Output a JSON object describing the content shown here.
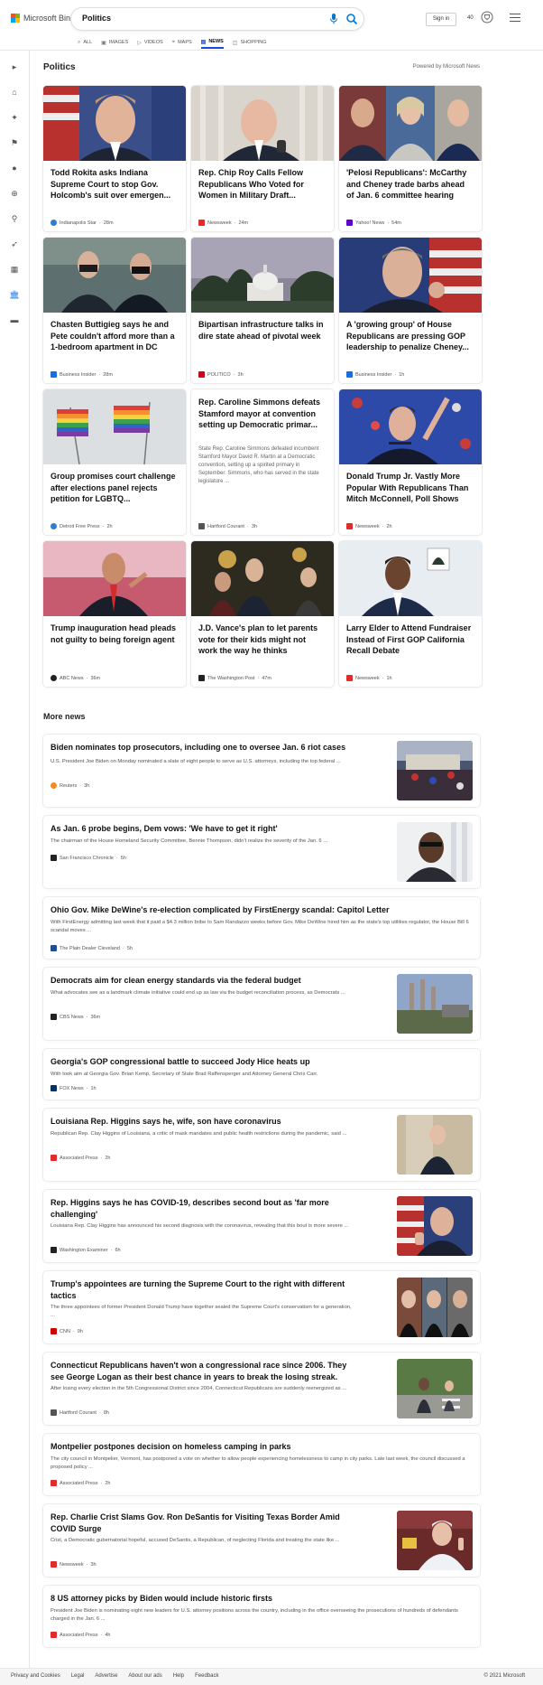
{
  "brand": {
    "name": "Microsoft Bing"
  },
  "search": {
    "value": "Politics"
  },
  "header": {
    "signin_label": "Sign in",
    "rewards_points": "40"
  },
  "nav": [
    {
      "label": "ALL",
      "icon": "search-icon",
      "active": false
    },
    {
      "label": "IMAGES",
      "icon": "image-icon",
      "active": false
    },
    {
      "label": "VIDEOS",
      "icon": "video-icon",
      "active": false
    },
    {
      "label": "MAPS",
      "icon": "map-pin-icon",
      "active": false
    },
    {
      "label": "NEWS",
      "icon": "news-icon",
      "active": true
    },
    {
      "label": "SHOPPING",
      "icon": "shopping-bag-icon",
      "active": false
    }
  ],
  "sidebar": [
    {
      "icon": "chevron-right-icon"
    },
    {
      "icon": "home-icon"
    },
    {
      "icon": "satellite-icon"
    },
    {
      "icon": "flag-icon"
    },
    {
      "icon": "map-pin-icon"
    },
    {
      "icon": "globe-icon"
    },
    {
      "icon": "microscope-icon"
    },
    {
      "icon": "rocket-icon"
    },
    {
      "icon": "film-icon"
    },
    {
      "icon": "politics-icon",
      "active": true
    },
    {
      "icon": "money-icon"
    }
  ],
  "section": {
    "title": "Politics",
    "powered_by": "Powered by Microsoft News"
  },
  "cards": [
    {
      "title": "Todd Rokita asks Indiana Supreme Court to stop Gov. Holcomb's suit over emergen...",
      "source": "Indianapolis Star",
      "time": "28m",
      "source_color": "#2e7dd1"
    },
    {
      "title": "Rep. Chip Roy Calls Fellow Republicans Who Voted for Women in Military Draft...",
      "source": "Newsweek",
      "time": "24m",
      "source_color": "#e22b2b"
    },
    {
      "title": "'Pelosi Republicans': McCarthy and Cheney trade barbs ahead of Jan. 6 committee hearing",
      "source": "Yahoo! News",
      "time": "54m",
      "source_color": "#6001d2"
    },
    {
      "title": "Chasten Buttigieg says he and Pete couldn't afford more than a 1-bedroom apartment in DC",
      "source": "Business Insider",
      "time": "28m",
      "source_color": "#1a6fe0"
    },
    {
      "title": "Bipartisan infrastructure talks in dire state ahead of pivotal week",
      "source": "POLITICO",
      "time": "3h",
      "source_color": "#d0021b"
    },
    {
      "title": "A 'growing group' of House Republicans are pressing GOP leadership to penalize Cheney...",
      "source": "Business Insider",
      "time": "1h",
      "source_color": "#1a6fe0"
    },
    {
      "title": "Group promises court challenge after elections panel rejects petition for LGBTQ...",
      "source": "Detroit Free Press",
      "time": "2h",
      "source_color": "#2e7dd1"
    },
    {
      "title": "Rep. Caroline Simmons defeats Stamford mayor at convention setting up Democratic primar...",
      "snippet": "State Rep. Caroline Simmons defeated incumbent Stamford Mayor David R. Martin at a Democratic convention, setting up a spirited primary in September. Simmons, who has served in the state legislature ...",
      "source": "Hartford Courant",
      "time": "3h",
      "source_color": "#555555"
    },
    {
      "title": "Donald Trump Jr. Vastly More Popular With Republicans Than Mitch McConnell, Poll Shows",
      "source": "Newsweek",
      "time": "2h",
      "source_color": "#e22b2b"
    },
    {
      "title": "Trump inauguration head pleads not guilty to being foreign agent",
      "source": "ABC News",
      "time": "36m",
      "source_color": "#222222"
    },
    {
      "title": "J.D. Vance's plan to let parents vote for their kids might not work the way he thinks",
      "source": "The Washington Post",
      "time": "47m",
      "source_color": "#222222"
    },
    {
      "title": "Larry Elder to Attend Fundraiser Instead of First GOP California Recall Debate",
      "source": "Newsweek",
      "time": "1h",
      "source_color": "#e22b2b"
    }
  ],
  "more_news": {
    "title": "More news",
    "items": [
      {
        "title": "Biden nominates top prosecutors, including one to oversee Jan. 6 riot cases",
        "snippet": "U.S. President Joe Biden on Monday nominated a slate of eight people to serve as U.S. attorneys, including the top federal ...",
        "source": "Reuters",
        "time": "3h",
        "source_color": "#f08a24"
      },
      {
        "title": "As Jan. 6 probe begins, Dem vows: 'We have to get it right'",
        "snippet": "The chairman of the House Homeland Security Committee, Bennie Thompson, didn't realize the severity of the Jan. 6 ...",
        "source": "San Francisco Chronicle",
        "time": "5h",
        "source_color": "#222222"
      },
      {
        "title": "Ohio Gov. Mike DeWine's re-election complicated by FirstEnergy scandal: Capitol Letter",
        "snippet": "With FirstEnergy admitting last week that it paid a $4.3 million bribe to Sam Randazzo weeks before Gov. Mike DeWine hired him as the state's top utilities regulator, the House Bill 6 scandal moves ...",
        "source": "The Plain Dealer Cleveland",
        "time": "5h",
        "source_color": "#1d4f91"
      },
      {
        "title": "Democrats aim for clean energy standards via the federal budget",
        "snippet": "What advocates see as a landmark climate initiative could end up as law via the budget reconciliation process, as Democrats ...",
        "source": "CBS News",
        "time": "36m",
        "source_color": "#222222"
      },
      {
        "title": "Georgia's GOP congressional battle to succeed Jody Hice heats up",
        "snippet": "With took aim at Georgia Gov. Brian Kemp, Secretary of State Brad Raffensperger and Attorney General Chris Carr.",
        "source": "FOX News",
        "time": "1h",
        "source_color": "#003366"
      },
      {
        "title": "Louisiana Rep. Higgins says he, wife, son have coronavirus",
        "snippet": "Republican Rep. Clay Higgins of Louisiana, a critic of mask mandates and public health restrictions during the pandemic, said ...",
        "source": "Associated Press",
        "time": "2h",
        "source_color": "#e22b2b"
      },
      {
        "title": "Rep. Higgins says he has COVID-19, describes second bout as 'far more challenging'",
        "snippet": "Louisiana Rep. Clay Higgins has announced his second diagnosis with the coronavirus, revealing that this bout is more severe ...",
        "source": "Washington Examiner",
        "time": "6h",
        "source_color": "#222222"
      },
      {
        "title": "Trump's appointees are turning the Supreme Court to the right with different tactics",
        "snippet": "The three appointees of former President Donald Trump have together sealed the Supreme Court's conservatism for a generation, ...",
        "source": "CNN",
        "time": "9h",
        "source_color": "#cc0000"
      },
      {
        "title": "Connecticut Republicans haven't won a congressional race since 2006. They see George Logan as their best chance in years to break the losing streak.",
        "snippet": "After losing every election in the 5th Congressional District since 2004, Connecticut Republicans are suddenly reenergized as ...",
        "source": "Hartford Courant",
        "time": "8h",
        "source_color": "#555555"
      },
      {
        "title": "Montpelier postpones decision on homeless camping in parks",
        "snippet": "The city council in Montpelier, Vermont, has postponed a vote on whether to allow people experiencing homelessness to camp in city parks. Late last week, the council discussed a proposed policy ...",
        "source": "Associated Press",
        "time": "2h",
        "source_color": "#e22b2b"
      },
      {
        "title": "Rep. Charlie Crist Slams Gov. Ron DeSantis for Visiting Texas Border Amid COVID Surge",
        "snippet": "Crist, a Democratic gubernatorial hopeful, accused DeSantis, a Republican, of neglecting Florida and treating the state like ...",
        "source": "Newsweek",
        "time": "3h",
        "source_color": "#e22b2b"
      },
      {
        "title": "8 US attorney picks by Biden would include historic firsts",
        "snippet": "President Joe Biden is nominating eight new leaders for U.S. attorney positions across the country, including in the office overseeing the prosecutions of hundreds of defendants charged in the Jan. 6 ...",
        "source": "Associated Press",
        "time": "4h",
        "source_color": "#e22b2b"
      }
    ]
  },
  "footer": {
    "links": [
      "Privacy and Cookies",
      "Legal",
      "Advertise",
      "About our ads",
      "Help",
      "Feedback"
    ],
    "copyright": "© 2021 Microsoft"
  }
}
